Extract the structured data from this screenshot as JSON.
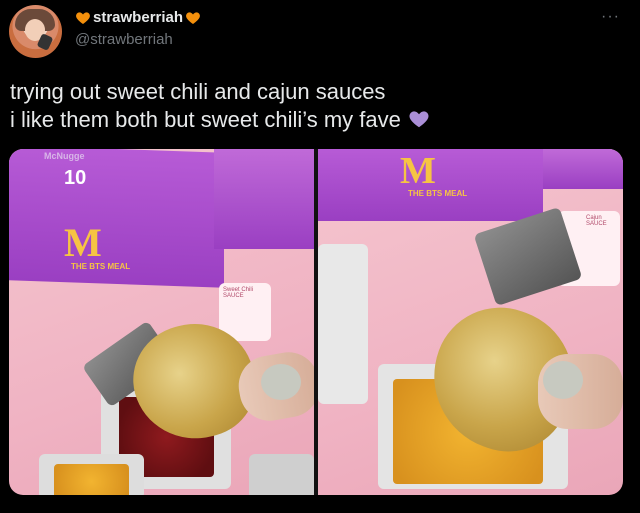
{
  "user": {
    "display_name": "strawberriah",
    "handle": "@strawberriah",
    "name_emoji": "orange-heart-icon"
  },
  "more_label": "···",
  "tweet": {
    "line1": "trying out sweet chili and cajun sauces",
    "line2": "i like them both but sweet chili’s my fave",
    "emoji": "purple-heart-icon"
  },
  "photos": {
    "left": {
      "box_top_text": "McNugge",
      "box_count": "10",
      "box_logo": "M",
      "box_meal_text": "THE BTS MEAL",
      "card_text": "Sweet Chili SAUCE"
    },
    "right": {
      "box_logo": "M",
      "box_meal_text": "THE BTS MEAL",
      "card_text": "Cajun SAUCE"
    }
  },
  "colors": {
    "background": "#000000",
    "text": "#e7e9ea",
    "secondary": "#71767b",
    "orange_heart": "#f4900c",
    "purple_heart": "#aa8ed6"
  }
}
